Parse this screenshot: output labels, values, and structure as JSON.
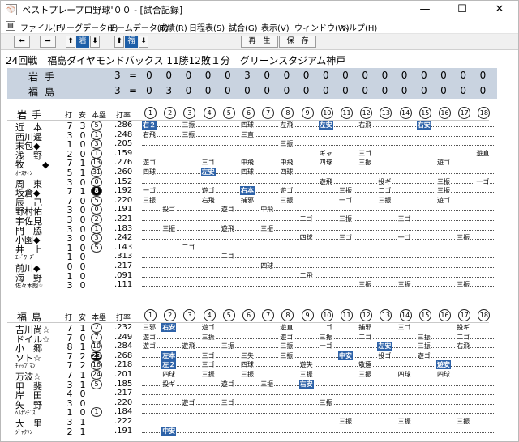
{
  "window": {
    "title": "ベストプレープロ野球'００ - [試合記録]",
    "icon": "app-icon",
    "min": "—",
    "max": "☐",
    "close": "✕"
  },
  "menu": [
    "ファイル(F)",
    "リーグデータ(L)",
    "チームデータ(T)",
    "成績(R)",
    "日程表(S)",
    "試合(G)",
    "表示(V)",
    "ウィンドウ(W)",
    "ヘルプ(H)"
  ],
  "toolbar": {
    "team1": "岩",
    "team2": "福",
    "replay": "再　生",
    "save": "保　存"
  },
  "heading": "24回戦　福島ダイヤモンドバックス 11勝12敗１分　グリーンスタジアム神戸",
  "linescore": [
    {
      "team": "岩手",
      "total": "3",
      "innings": [
        "0",
        "0",
        "0",
        "0",
        "0",
        "3",
        "0",
        "0",
        "0",
        "0",
        "0",
        "0",
        "0",
        "0",
        "0",
        "0",
        "0",
        "0"
      ]
    },
    {
      "team": "福島",
      "total": "3",
      "innings": [
        "0",
        "3",
        "0",
        "0",
        "0",
        "0",
        "0",
        "0",
        "0",
        "0",
        "0",
        "0",
        "0",
        "0",
        "0",
        "0",
        "0",
        "0"
      ]
    }
  ],
  "headers": {
    "ab": "打",
    "hits": "安",
    "hr": "本塁",
    "avg": "打率"
  },
  "inning_labels": [
    "1",
    "2",
    "3",
    "4",
    "5",
    "6",
    "7",
    "8",
    "9",
    "10",
    "11",
    "12",
    "13",
    "14",
    "15",
    "16",
    "17",
    "18"
  ],
  "teams": [
    {
      "name": "岩手",
      "players": [
        {
          "name": "近　本",
          "ab": "7",
          "h": "3",
          "hr": "5",
          "avg": ".286",
          "hrfill": false,
          "res": [
            {
              "i": 0,
              "t": "右２",
              "hit": true
            },
            {
              "i": 2,
              "t": "三振"
            },
            {
              "i": 5,
              "t": "四球"
            },
            {
              "i": 7,
              "t": "左飛"
            },
            {
              "i": 9,
              "t": "左安",
              "hit": true
            },
            {
              "i": 11,
              "t": "右飛"
            },
            {
              "i": 14,
              "t": "右安",
              "hit": true
            }
          ]
        },
        {
          "name": "西川遥",
          "ab": "3",
          "h": "0",
          "hr": "1",
          "avg": ".248",
          "res": [
            {
              "i": 0,
              "t": "右飛"
            },
            {
              "i": 2,
              "t": "三振"
            },
            {
              "i": 5,
              "t": "三直"
            }
          ]
        },
        {
          "name": "末包◆",
          "ab": "1",
          "h": "0",
          "hr": "3",
          "avg": ".205",
          "res": [
            {
              "i": 7,
              "t": "三振"
            }
          ]
        },
        {
          "name": "浅　野",
          "ab": "2",
          "h": "0",
          "hr": "1",
          "avg": ".159",
          "res": [
            {
              "i": 9,
              "t": "ギャ"
            },
            {
              "i": 11,
              "t": "三ゴ"
            },
            {
              "i": 17,
              "t": "遊直"
            }
          ]
        },
        {
          "name": "牧　　◆",
          "ab": "7",
          "h": "1",
          "hr": "13",
          "avg": ".276",
          "res": [
            {
              "i": 0,
              "t": "遊ゴ"
            },
            {
              "i": 3,
              "t": "三ゴ"
            },
            {
              "i": 5,
              "t": "中飛"
            },
            {
              "i": 7,
              "t": "中飛"
            },
            {
              "i": 9,
              "t": "四球"
            },
            {
              "i": 11,
              "t": "三振"
            },
            {
              "i": 15,
              "t": "遊ゴ"
            }
          ]
        },
        {
          "name": "ｵｰｽﾃｨﾝ",
          "small": true,
          "ab": "5",
          "h": "1",
          "hr": "31",
          "avg": ".260",
          "res": [
            {
              "i": 0,
              "t": "四球"
            },
            {
              "i": 3,
              "t": "左安",
              "hit": true
            },
            {
              "i": 5,
              "t": "四球"
            },
            {
              "i": 7,
              "t": "四球"
            }
          ]
        },
        {
          "name": "周　東",
          "ab": "3",
          "h": "0",
          "hr": "0",
          "avg": ".152",
          "res": [
            {
              "i": 9,
              "t": "遊飛"
            },
            {
              "i": 12,
              "t": "投ギ"
            },
            {
              "i": 15,
              "t": "三振"
            },
            {
              "i": 17,
              "t": "一ゴ"
            }
          ]
        },
        {
          "name": "坂倉◆",
          "ab": "7",
          "h": "1",
          "hr": "8",
          "avg": ".192",
          "hrfill": true,
          "res": [
            {
              "i": 0,
              "t": "一ゴ"
            },
            {
              "i": 3,
              "t": "遊ゴ"
            },
            {
              "i": 5,
              "t": "右本",
              "hit": true
            },
            {
              "i": 7,
              "t": "遊ゴ"
            },
            {
              "i": 10,
              "t": "三振"
            },
            {
              "i": 12,
              "t": "二ゴ"
            },
            {
              "i": 15,
              "t": "三振"
            }
          ]
        },
        {
          "name": "辰　己",
          "ab": "7",
          "h": "0",
          "hr": "5",
          "avg": ".220",
          "res": [
            {
              "i": 0,
              "t": "三振"
            },
            {
              "i": 3,
              "t": "右飛"
            },
            {
              "i": 5,
              "t": "捕邪"
            },
            {
              "i": 7,
              "t": "三振"
            },
            {
              "i": 10,
              "t": "一ゴ"
            },
            {
              "i": 12,
              "t": "三振"
            },
            {
              "i": 15,
              "t": "遊ゴ"
            }
          ]
        },
        {
          "name": "野村佑",
          "ab": "3",
          "h": "0",
          "hr": "0",
          "avg": ".191",
          "res": [
            {
              "i": 1,
              "t": "投ゴ"
            },
            {
              "i": 4,
              "t": "遊ゴ"
            },
            {
              "i": 6,
              "t": "中飛"
            }
          ]
        },
        {
          "name": "宇佐見",
          "ab": "3",
          "h": "0",
          "hr": "2",
          "avg": ".221",
          "res": [
            {
              "i": 8,
              "t": "二ゴ"
            },
            {
              "i": 10,
              "t": "三振"
            },
            {
              "i": 13,
              "t": "三ゴ"
            }
          ]
        },
        {
          "name": "門　脇",
          "ab": "3",
          "h": "0",
          "hr": "1",
          "avg": ".183",
          "res": [
            {
              "i": 1,
              "t": "三振"
            },
            {
              "i": 4,
              "t": "遊飛"
            },
            {
              "i": 6,
              "t": "三振"
            }
          ]
        },
        {
          "name": "小園◆",
          "ab": "3",
          "h": "0",
          "hr": "3",
          "avg": ".242",
          "res": [
            {
              "i": 8,
              "t": "四球"
            },
            {
              "i": 10,
              "t": "三ゴ"
            },
            {
              "i": 13,
              "t": "一ゴ"
            },
            {
              "i": 16,
              "t": "三振"
            }
          ]
        },
        {
          "name": "井　上",
          "ab": "1",
          "h": "0",
          "hr": "5",
          "avg": ".143",
          "res": [
            {
              "i": 2,
              "t": "二ゴ"
            }
          ]
        },
        {
          "name": "ｴﾄﾞﾜｰｽﾞ",
          "small": true,
          "ab": "1",
          "h": "0",
          "avg": ".313",
          "res": [
            {
              "i": 4,
              "t": "二ゴ"
            }
          ]
        },
        {
          "name": "前川◆",
          "ab": "0",
          "h": "0",
          "avg": ".217",
          "res": [
            {
              "i": 6,
              "t": "四球"
            }
          ]
        },
        {
          "name": "海　野",
          "ab": "1",
          "h": "0",
          "avg": ".091",
          "res": [
            {
              "i": 8,
              "t": "二飛"
            }
          ]
        },
        {
          "name": "佐々木朗☆",
          "small": true,
          "ab": "3",
          "h": "0",
          "avg": ".111",
          "res": [
            {
              "i": 11,
              "t": "三振"
            },
            {
              "i": 13,
              "t": "三振"
            },
            {
              "i": 16,
              "t": "三振"
            }
          ]
        }
      ]
    },
    {
      "name": "福島",
      "players": [
        {
          "name": "吉川尚☆",
          "ab": "7",
          "h": "1",
          "hr": "2",
          "avg": ".232",
          "res": [
            {
              "i": 0,
              "t": "三邪"
            },
            {
              "i": 1,
              "t": "右安",
              "hit": true
            },
            {
              "i": 3,
              "t": "遊ゴ"
            },
            {
              "i": 7,
              "t": "遊直"
            },
            {
              "i": 9,
              "t": "二ゴ"
            },
            {
              "i": 11,
              "t": "捕邪"
            },
            {
              "i": 13,
              "t": "三ゴ"
            },
            {
              "i": 16,
              "t": "投ギ"
            }
          ]
        },
        {
          "name": "ドイル☆",
          "ab": "7",
          "h": "0",
          "hr": "7",
          "avg": ".249",
          "res": [
            {
              "i": 0,
              "t": "遊ゴ"
            },
            {
              "i": 3,
              "t": "三振"
            },
            {
              "i": 7,
              "t": "遊ゴ"
            },
            {
              "i": 9,
              "t": "三振"
            },
            {
              "i": 11,
              "t": "二ゴ"
            },
            {
              "i": 14,
              "t": "三振"
            },
            {
              "i": 16,
              "t": "二ゴ"
            }
          ]
        },
        {
          "name": "小　郷",
          "ab": "8",
          "h": "1",
          "hr": "10",
          "avg": ".284",
          "res": [
            {
              "i": 0,
              "t": "遊ゴ"
            },
            {
              "i": 2,
              "t": "遊飛"
            },
            {
              "i": 4,
              "t": "三振"
            },
            {
              "i": 7,
              "t": "三振"
            },
            {
              "i": 9,
              "t": "一ゴ"
            },
            {
              "i": 12,
              "t": "左安",
              "hit": true
            },
            {
              "i": 14,
              "t": "三振"
            },
            {
              "i": 16,
              "t": "右飛"
            }
          ]
        },
        {
          "name": "ソト☆",
          "ab": "7",
          "h": "2",
          "hr": "23",
          "avg": ".268",
          "hrfill": true,
          "res": [
            {
              "i": 1,
              "t": "左本",
              "hit": true
            },
            {
              "i": 3,
              "t": "三ゴ"
            },
            {
              "i": 5,
              "t": "三失"
            },
            {
              "i": 7,
              "t": "三振"
            },
            {
              "i": 10,
              "t": "中安",
              "hit": true
            },
            {
              "i": 12,
              "t": "投ゴ"
            },
            {
              "i": 14,
              "t": "遊ゴ"
            }
          ]
        },
        {
          "name": "ﾁｬｯﾌﾟﾏﾝ",
          "small": true,
          "ab": "7",
          "h": "2",
          "hr": "16",
          "avg": ".218",
          "res": [
            {
              "i": 1,
              "t": "左２",
              "hit": true
            },
            {
              "i": 3,
              "t": "三ゴ"
            },
            {
              "i": 5,
              "t": "四球"
            },
            {
              "i": 8,
              "t": "遊失"
            },
            {
              "i": 11,
              "t": "敬遠"
            },
            {
              "i": 15,
              "t": "遊安",
              "hit": true
            }
          ]
        },
        {
          "name": "万波☆",
          "ab": "7",
          "h": "1",
          "hr": "24",
          "avg": ".201",
          "res": [
            {
              "i": 1,
              "t": "四球"
            },
            {
              "i": 3,
              "t": "三振"
            },
            {
              "i": 5,
              "t": "三振"
            },
            {
              "i": 8,
              "t": "三振"
            },
            {
              "i": 11,
              "t": "三振"
            },
            {
              "i": 13,
              "t": "四球"
            },
            {
              "i": 15,
              "t": "四球"
            }
          ]
        },
        {
          "name": "甲　斐",
          "ab": "3",
          "h": "1",
          "hr": "5",
          "avg": ".185",
          "res": [
            {
              "i": 1,
              "t": "投ギ"
            },
            {
              "i": 4,
              "t": "遊ゴ"
            },
            {
              "i": 6,
              "t": "三振"
            },
            {
              "i": 8,
              "t": "右安",
              "hit": true
            }
          ]
        },
        {
          "name": "岸　田",
          "ab": "4",
          "h": "0",
          "avg": ".217",
          "res": []
        },
        {
          "name": "矢　野",
          "ab": "3",
          "h": "0",
          "avg": ".220",
          "res": [
            {
              "i": 2,
              "t": "遊ゴ"
            },
            {
              "i": 4,
              "t": "三ゴ"
            },
            {
              "i": 9,
              "t": "三振"
            }
          ]
        },
        {
          "name": "ﾍﾙﾅﾝﾃﾞｽ",
          "small": true,
          "ab": "1",
          "h": "0",
          "hr": "1",
          "avg": ".184",
          "res": []
        },
        {
          "name": "大　里",
          "ab": "3",
          "h": "1",
          "avg": ".222",
          "res": [
            {
              "i": 10,
              "t": "三振"
            },
            {
              "i": 13,
              "t": "三振"
            },
            {
              "i": 16,
              "t": "三振"
            }
          ]
        },
        {
          "name": "ｼﾞｬｸｿﾝ",
          "small": true,
          "ab": "2",
          "h": "1",
          "avg": ".191",
          "res": [
            {
              "i": 1,
              "t": "中安",
              "hit": true
            }
          ]
        }
      ]
    }
  ]
}
